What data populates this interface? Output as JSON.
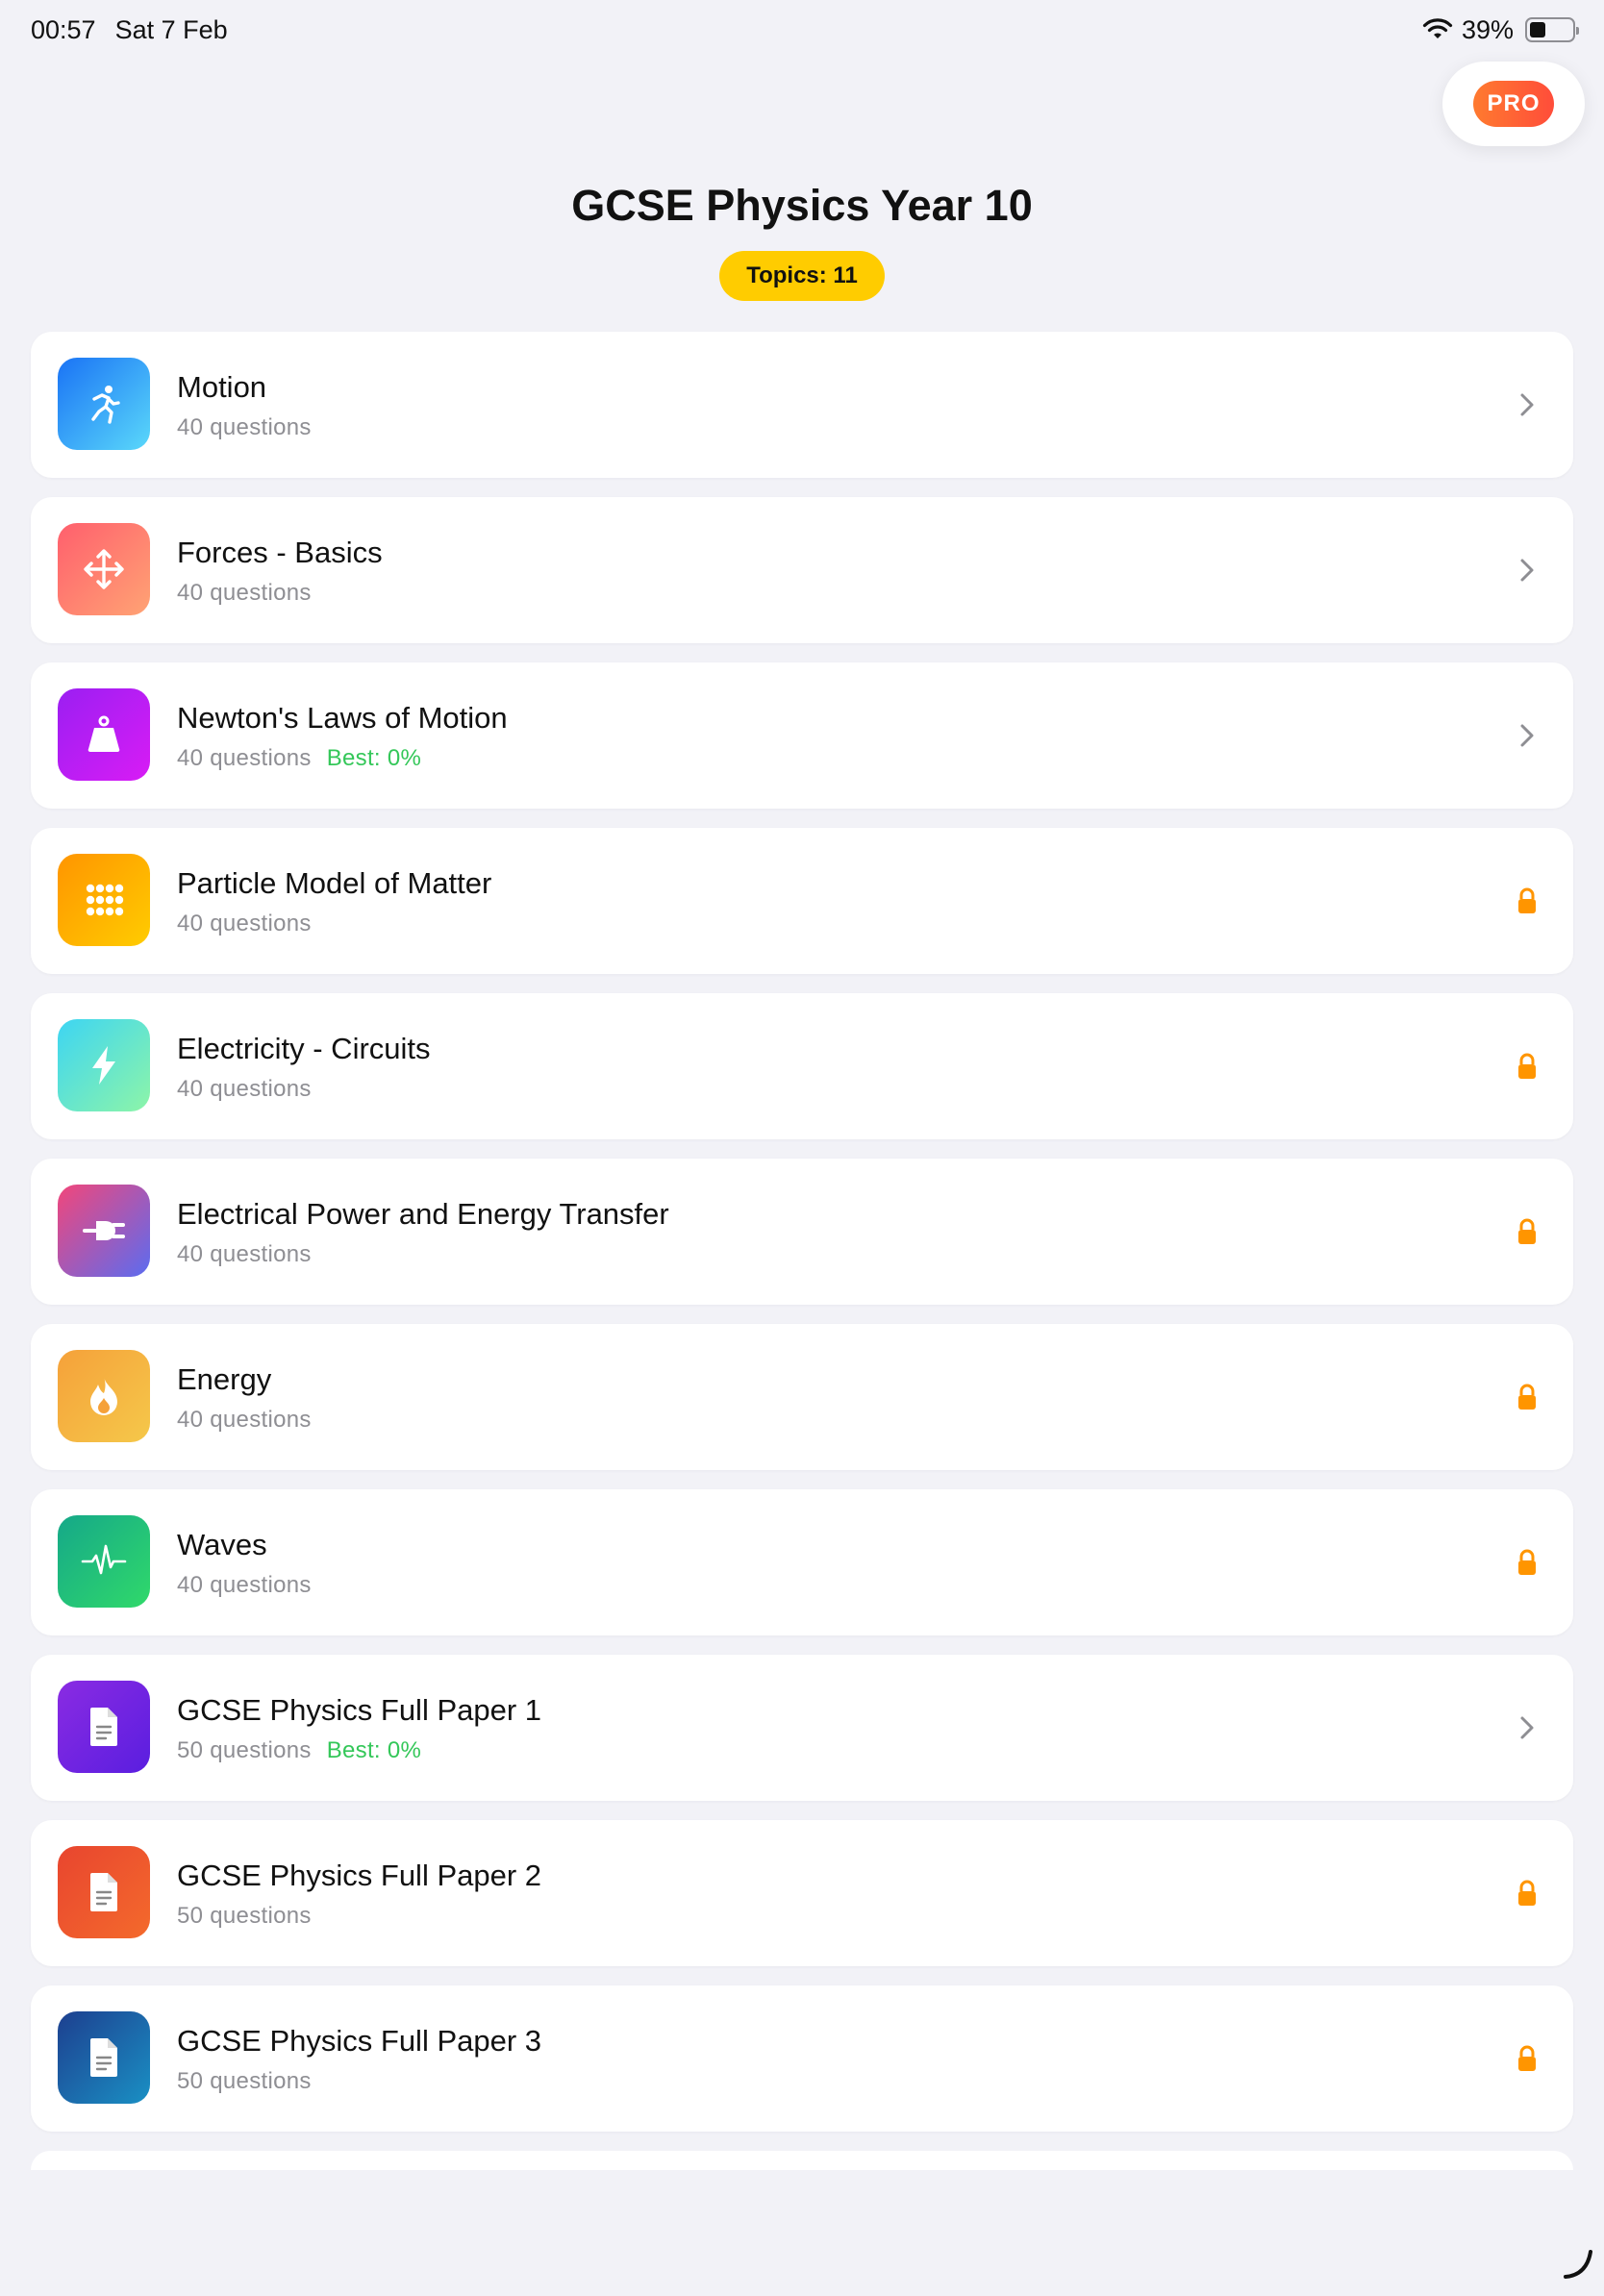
{
  "status": {
    "time": "00:57",
    "date": "Sat 7 Feb",
    "battery": "39%",
    "battery_level": 0.39
  },
  "pro_label": "PRO",
  "header": {
    "title": "GCSE Physics Year 10",
    "topics_badge": "Topics: 11"
  },
  "colors": {
    "background": "#f2f2f7",
    "accent_yellow": "#ffcc00",
    "pro_orange": "#ff5a36",
    "best_green": "#34c759",
    "lock_orange": "#ff9500"
  },
  "topics": [
    {
      "title": "Motion",
      "questions": "40 questions",
      "best": "",
      "icon": "running-figure-icon",
      "status": "open",
      "gradient": [
        "#1a73f5",
        "#5ad8fa"
      ]
    },
    {
      "title": "Forces - Basics",
      "questions": "40 questions",
      "best": "",
      "icon": "move-arrows-icon",
      "status": "open",
      "gradient": [
        "#ff5f6d",
        "#ffa374"
      ]
    },
    {
      "title": "Newton's Laws of Motion",
      "questions": "40 questions",
      "best": "Best: 0%",
      "icon": "weight-icon",
      "status": "open",
      "gradient": [
        "#9b1ff2",
        "#d81cf5"
      ]
    },
    {
      "title": "Particle Model of Matter",
      "questions": "40 questions",
      "best": "",
      "icon": "dots-grid-icon",
      "status": "locked",
      "gradient": [
        "#ff9500",
        "#ffcc00"
      ]
    },
    {
      "title": "Electricity - Circuits",
      "questions": "40 questions",
      "best": "",
      "icon": "bolt-icon",
      "status": "locked",
      "gradient": [
        "#3dd5f3",
        "#8df5a8"
      ]
    },
    {
      "title": "Electrical Power and Energy Transfer",
      "questions": "40 questions",
      "best": "",
      "icon": "plug-icon",
      "status": "locked",
      "gradient": [
        "#f2467a",
        "#5b6cf0"
      ]
    },
    {
      "title": "Energy",
      "questions": "40 questions",
      "best": "",
      "icon": "flame-icon",
      "status": "locked",
      "gradient": [
        "#f5a13a",
        "#f5c84a"
      ]
    },
    {
      "title": "Waves",
      "questions": "40 questions",
      "best": "",
      "icon": "waveform-icon",
      "status": "locked",
      "gradient": [
        "#15a889",
        "#30d96a"
      ]
    },
    {
      "title": "GCSE Physics Full Paper 1",
      "questions": "50 questions",
      "best": "Best: 0%",
      "icon": "document-icon",
      "status": "open",
      "gradient": [
        "#8a2be2",
        "#5a1ee0"
      ]
    },
    {
      "title": "GCSE Physics Full Paper 2",
      "questions": "50 questions",
      "best": "",
      "icon": "document-icon",
      "status": "locked",
      "gradient": [
        "#e8452f",
        "#f46a2c"
      ]
    },
    {
      "title": "GCSE Physics Full Paper 3",
      "questions": "50 questions",
      "best": "",
      "icon": "document-icon",
      "status": "locked",
      "gradient": [
        "#1d3f8f",
        "#1a90c4"
      ]
    }
  ]
}
